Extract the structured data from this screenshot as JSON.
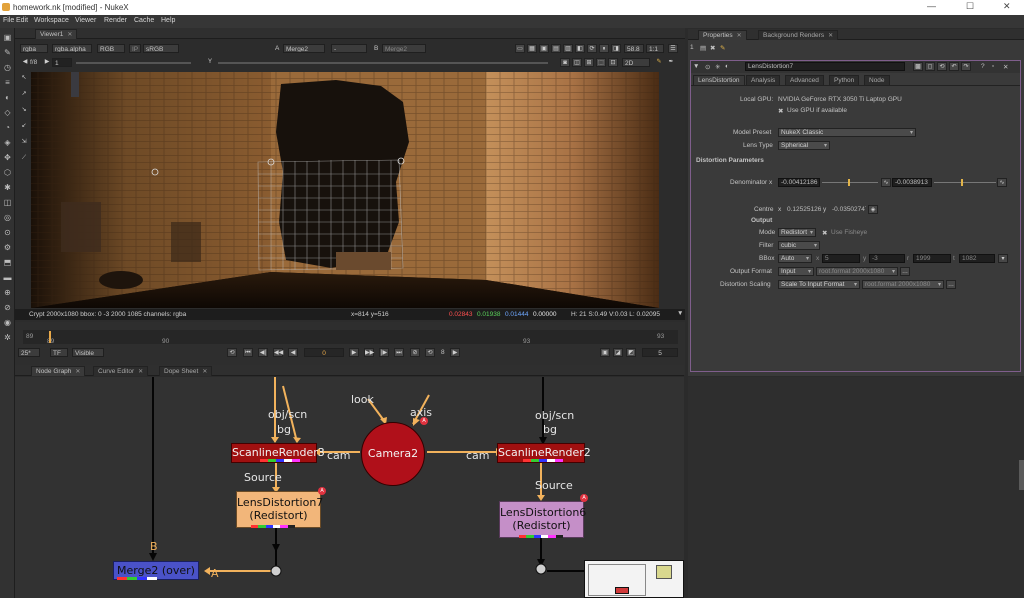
{
  "window": {
    "title": "homework.nk [modified] - NukeX",
    "controls": {
      "minimize": "—",
      "maximize": "☐",
      "close": "✕"
    }
  },
  "menu": [
    "File",
    "Edit",
    "Workspace",
    "Viewer",
    "Render",
    "Cache",
    "Help"
  ],
  "viewer": {
    "tab": "Viewer1",
    "toolbar": {
      "channels": "rgba",
      "alpha": "rgba.alpha",
      "display": "RGB",
      "ip": "IP",
      "colorspace": "sRGB",
      "a_label": "A",
      "a_input": "Merge2",
      "ab_mode": "-",
      "b_label": "B",
      "b_input": "Merge2",
      "zoom": "58.8",
      "ratio": "1:1",
      "fstop": "f/8",
      "frame_field": "1",
      "mode2d": "2D"
    },
    "info_left": "Crypt 2000x1080  bbox: 0 -3 2000 1085 channels: rgba",
    "info_coords": "x=814 y=516",
    "info_rgb": {
      "r": "0.02843",
      "g": "0.01938",
      "b": "0.01444",
      "a": "0.00000"
    },
    "info_right": "H: 21 S:0.49 V:0.03  L: 0.02095"
  },
  "timeline": {
    "start": "89",
    "start_sub": "89",
    "mark1": "90",
    "mark2": "93",
    "end": "93",
    "fps": "25*",
    "tf": "TF",
    "visible": "Visible",
    "current_frame": "0",
    "step": "8",
    "end_field": "5",
    "transport": [
      "⏮",
      "◀|",
      "◀◀",
      "◀",
      "▶",
      "▶▶",
      "|▶",
      "⏭"
    ]
  },
  "node_graph": {
    "tabs": [
      "Node Graph",
      "Curve Editor",
      "Dope Sheet"
    ],
    "nodes": {
      "scanline3": "ScanlineRender3",
      "scanline2": "ScanlineRender2",
      "camera": "Camera2",
      "lens7_name": "LensDistortion7",
      "lens7_mode": "(Redistort)",
      "lens6_name": "LensDistortion6",
      "lens6_mode": "(Redistort)",
      "merge": "Merge2 (over)"
    },
    "labels": {
      "objscn_left": "obj/scn",
      "bg_left": "bg",
      "cam_left": "cam",
      "look": "look",
      "axis": "axis",
      "objscn_right": "obj/scn",
      "bg_right": "bg",
      "cam_right": "cam",
      "source_left": "Source",
      "source_right": "Source",
      "merge_b": "B",
      "merge_a": "A"
    },
    "badge": "A"
  },
  "properties": {
    "tabs": [
      "Properties",
      "Background Renders"
    ],
    "node_name": "LensDistortion7",
    "node_tabs": [
      "LensDistortion",
      "Analysis",
      "Advanced",
      "Python",
      "Node"
    ],
    "local_gpu_label": "Local GPU:",
    "local_gpu_value": "NVIDIA GeForce RTX 3050 Ti Laptop GPU",
    "use_gpu": "Use GPU if available",
    "model_preset_label": "Model Preset",
    "model_preset": "NukeX Classic",
    "lens_type_label": "Lens Type",
    "lens_type": "Spherical",
    "section_distortion": "Distortion Parameters",
    "denominator_label": "Denominator x",
    "denominator_x": "-0.00412186",
    "denominator_y": "-0.0038913",
    "centre_label": "Centre",
    "centre_x_lbl": "x",
    "centre_x": "0.12525126",
    "centre_y_lbl": "y",
    "centre_y": "-0.03502747",
    "section_output": "Output",
    "mode_label": "Mode",
    "mode": "Redistort",
    "use_fisheye": "Use Fisheye",
    "filter_label": "Filter",
    "filter": "cubic",
    "bbox_label": "BBox",
    "bbox": "Auto",
    "bbox_x_lbl": "x",
    "bbox_x": "5",
    "bbox_y_lbl": "y",
    "bbox_y": "-3",
    "bbox_r_lbl": "r",
    "bbox_r": "1999",
    "bbox_t_lbl": "t",
    "bbox_t": "1082",
    "output_format_label": "Output Format",
    "output_format": "Input",
    "output_format_value": "root.format 2000x1080",
    "dist_scaling_label": "Distortion Scaling",
    "dist_scaling": "Scale To Input Format",
    "dist_scaling_value": "root.format 2000x1080"
  },
  "colors": {
    "scanline": "#a01010",
    "camera": "#b0101a",
    "lens7": "#f2b67a",
    "lens6": "#c58fc8",
    "merge": "#4a52c8",
    "pipe": "#f2b25c",
    "accent": "#7f5e8c"
  }
}
